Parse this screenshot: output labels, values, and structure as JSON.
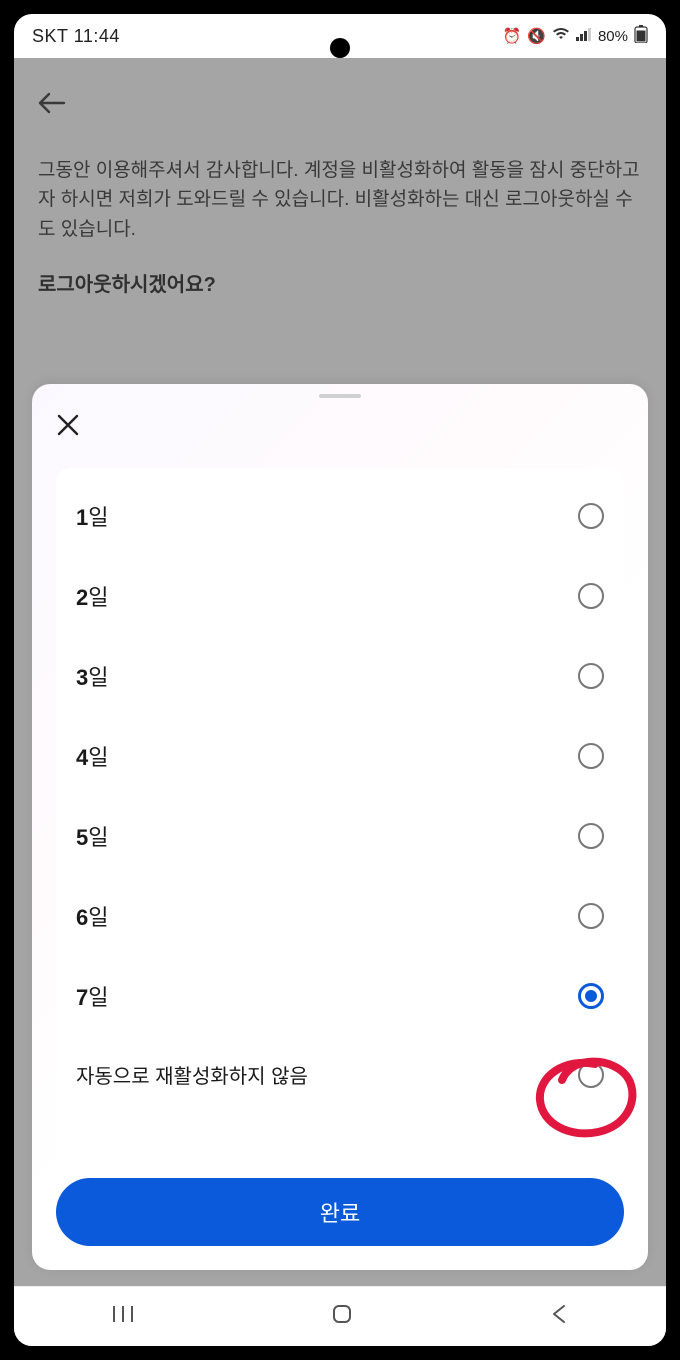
{
  "statusBar": {
    "carrier": "SKT",
    "time": "11:44",
    "batteryText": "80%"
  },
  "background": {
    "bodyText": "그동안 이용해주셔서 감사합니다. 계정을 비활성화하여 활동을 잠시 중단하고자 하시면 저희가 도와드릴 수 있습니다. 비활성화하는 대신 로그아웃하실 수도 있습니다.",
    "heading": "로그아웃하시겠어요?"
  },
  "sheet": {
    "options": [
      {
        "label": "1일",
        "selected": false
      },
      {
        "label": "2일",
        "selected": false
      },
      {
        "label": "3일",
        "selected": false
      },
      {
        "label": "4일",
        "selected": false
      },
      {
        "label": "5일",
        "selected": false
      },
      {
        "label": "6일",
        "selected": false
      },
      {
        "label": "7일",
        "selected": true
      },
      {
        "label": "자동으로 재활성화하지 않음",
        "selected": false
      }
    ],
    "doneLabel": "완료"
  }
}
